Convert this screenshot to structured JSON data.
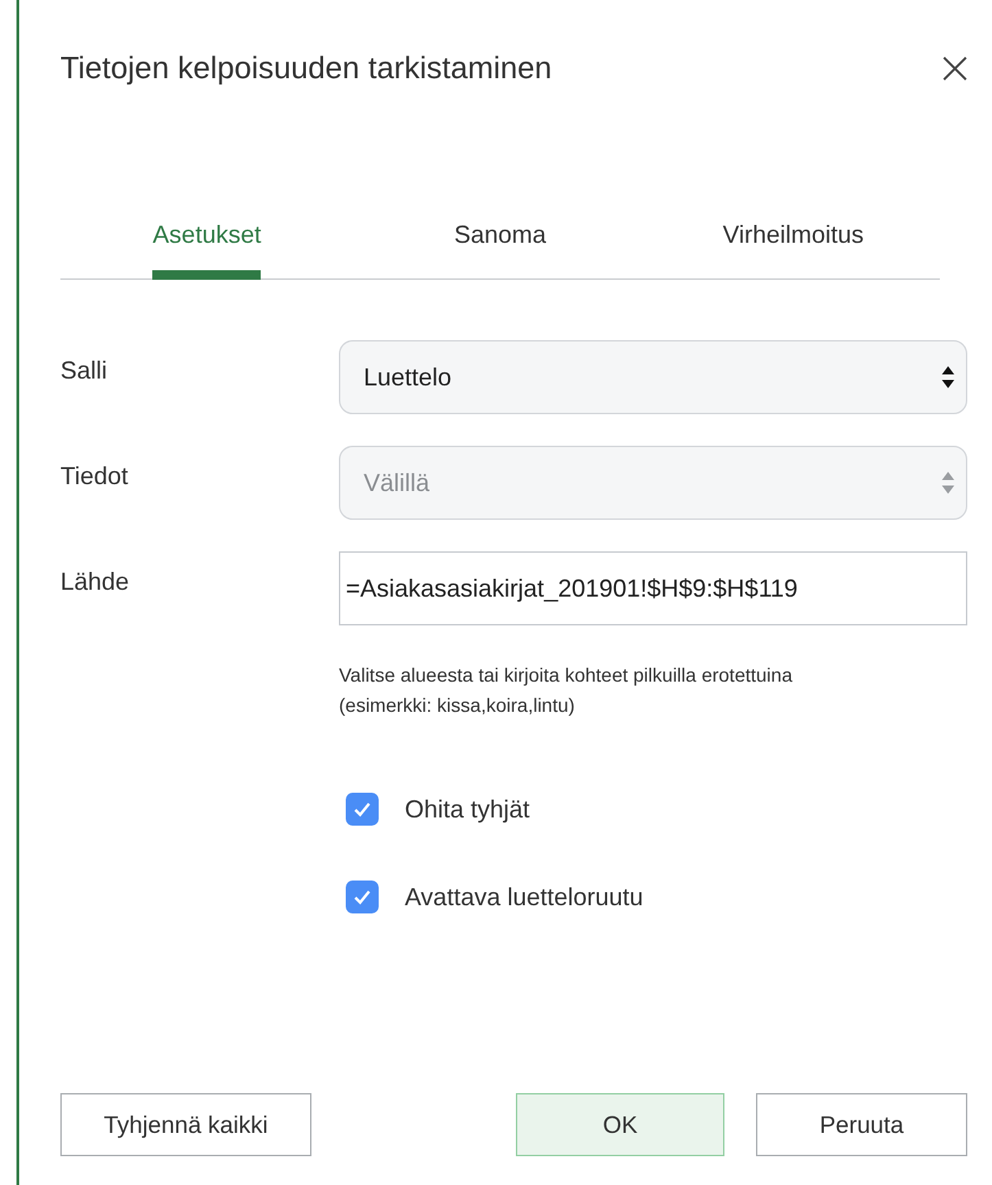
{
  "window": {
    "title": "Tietojen kelpoisuuden tarkistaminen"
  },
  "tabs": [
    {
      "label": "Asetukset",
      "selected": true
    },
    {
      "label": "Sanoma",
      "selected": false
    },
    {
      "label": "Virheilmoitus",
      "selected": false
    }
  ],
  "fields": [
    {
      "label": "Salli",
      "kind": "select",
      "value": "Luettelo",
      "disabled": false
    },
    {
      "label": "Tiedot",
      "kind": "select",
      "value": "Välillä",
      "disabled": true
    },
    {
      "label": "Lähde",
      "kind": "input",
      "value": "=Asiakasasiakirjat_201901!$H$9:$H$119"
    }
  ],
  "hint": "Valitse alueesta tai kirjoita kohteet pilkuilla erotettuina (esimerkki: kissa,koira,lintu)",
  "checkboxes": [
    {
      "label": "Ohita tyhjät",
      "checked": true
    },
    {
      "label": "Avattava luetteloruutu",
      "checked": true
    }
  ],
  "buttons": [
    {
      "label": "Tyhjennä kaikki",
      "kind": "secondary"
    },
    {
      "label": "OK",
      "kind": "primary"
    },
    {
      "label": "Peruuta",
      "kind": "secondary"
    }
  ]
}
